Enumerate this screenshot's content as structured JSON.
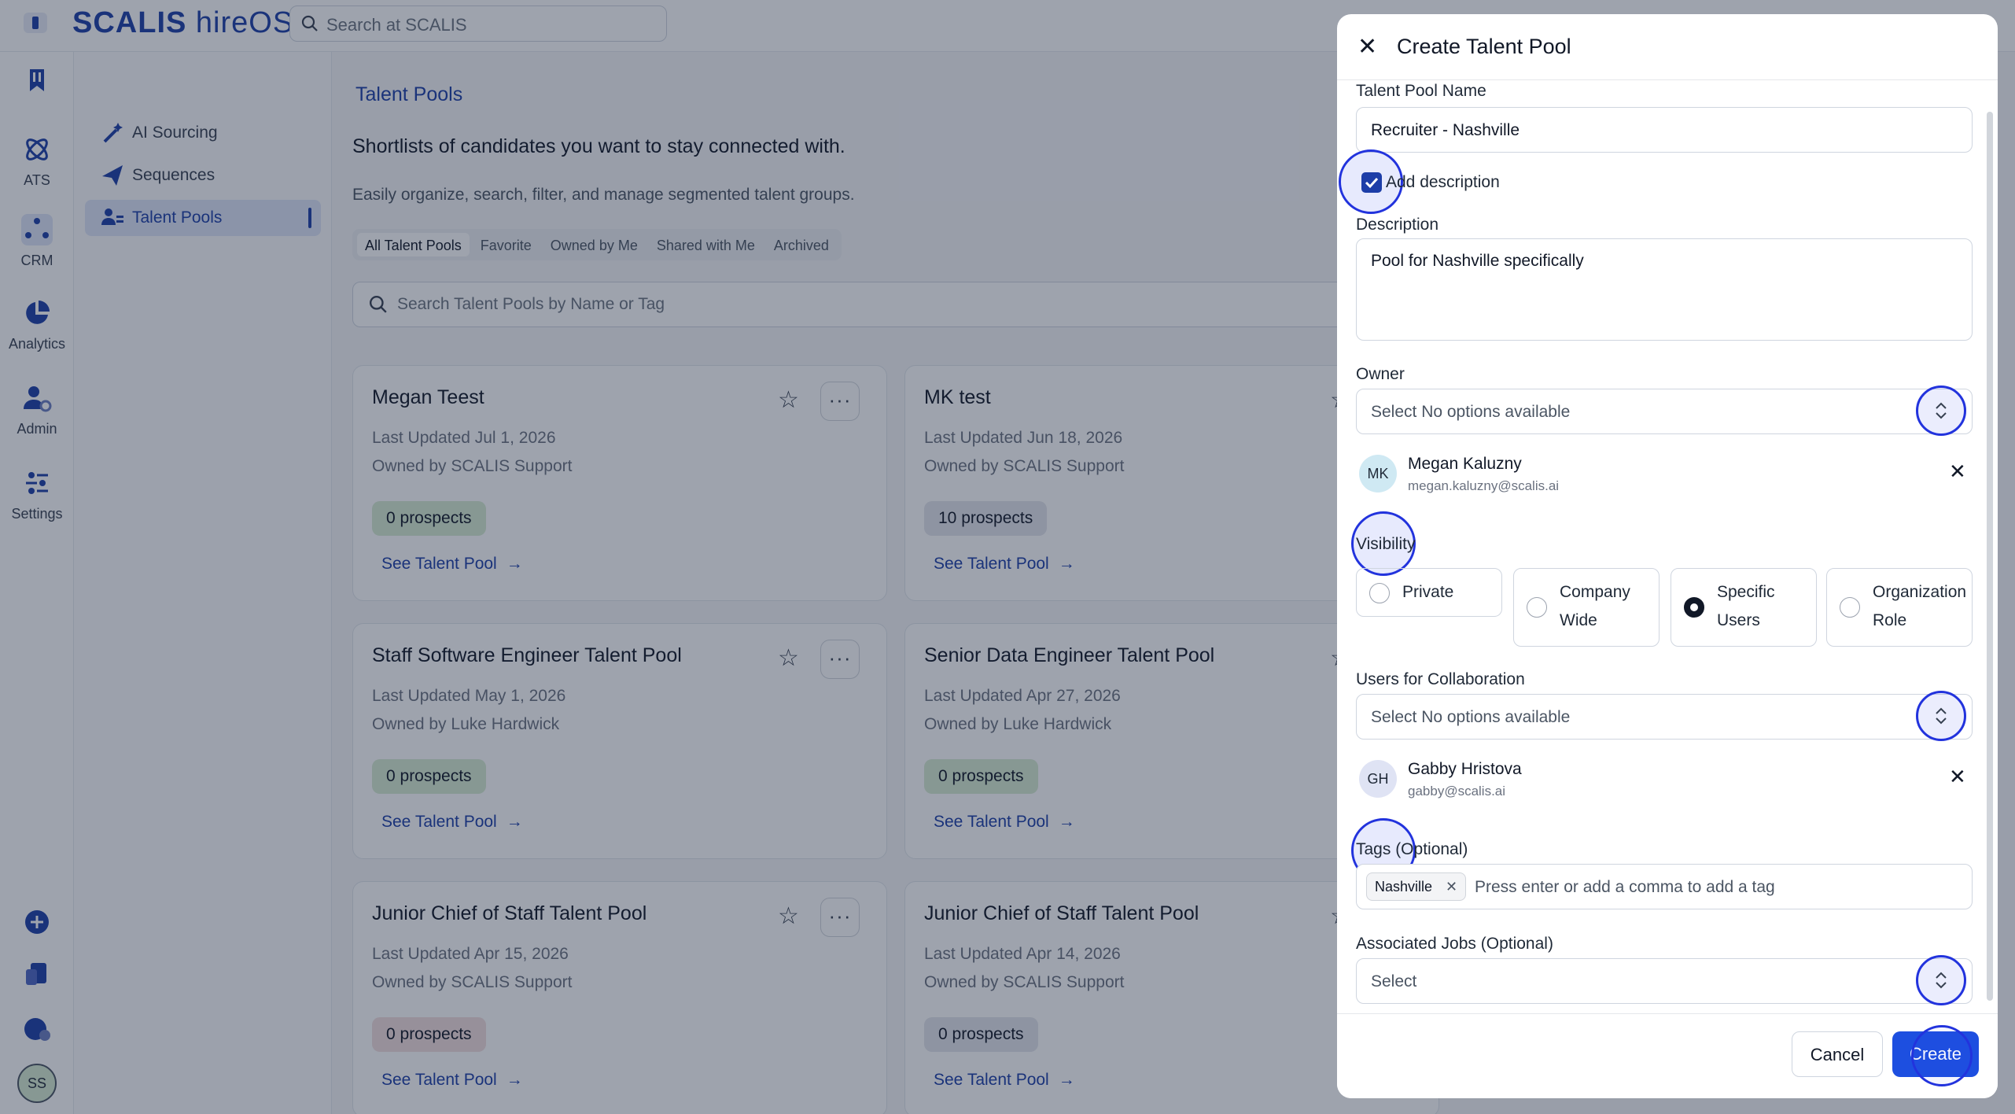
{
  "app": {
    "logo_brand": "SCALIS",
    "logo_product": "hireOS",
    "search_placeholder": "Search at SCALIS"
  },
  "rail": {
    "items": [
      {
        "label": "",
        "icon": "bookmark-icon"
      },
      {
        "label": "ATS",
        "icon": "atom-icon"
      },
      {
        "label": "CRM",
        "icon": "crm-dots-icon"
      },
      {
        "label": "Analytics",
        "icon": "pie-chart-icon"
      },
      {
        "label": "Admin",
        "icon": "user-gear-icon"
      },
      {
        "label": "Settings",
        "icon": "sliders-icon"
      }
    ],
    "user_initials": "SS"
  },
  "subnav": {
    "items": [
      {
        "label": "AI Sourcing",
        "icon": "magic-wand-icon"
      },
      {
        "label": "Sequences",
        "icon": "send-icon"
      },
      {
        "label": "Talent Pools",
        "icon": "people-icon",
        "active": true
      }
    ]
  },
  "main": {
    "breadcrumb": "Talent Pools",
    "heading": "Shortlists of candidates you want to stay connected with.",
    "subheading": "Easily organize, search, filter, and manage segmented talent groups.",
    "filters": [
      "All Talent Pools",
      "Favorite",
      "Owned by Me",
      "Shared with Me",
      "Archived"
    ],
    "search_placeholder": "Search Talent Pools by Name or Tag",
    "link_label": "See Talent Pool",
    "cards": [
      {
        "title": "Megan Teest",
        "updated": "Last Updated Jul 1, 2026",
        "owner": "Owned by SCALIS Support",
        "prospects": "0 prospects",
        "badge_color": "#d7ecd3"
      },
      {
        "title": "MK test",
        "updated": "Last Updated Jun 18, 2026",
        "owner": "Owned by SCALIS Support",
        "prospects": "10 prospects",
        "badge_color": "#e3e5ec"
      },
      {
        "title": "Staff Software Engineer Talent Pool",
        "updated": "Last Updated May 1, 2026",
        "owner": "Owned by Luke Hardwick",
        "prospects": "0 prospects",
        "badge_color": "#d7ecd3"
      },
      {
        "title": "Senior Data Engineer Talent Pool",
        "updated": "Last Updated Apr 27, 2026",
        "owner": "Owned by Luke Hardwick",
        "prospects": "0 prospects",
        "badge_color": "#d7ecd3"
      },
      {
        "title": "Junior Chief of Staff Talent Pool",
        "updated": "Last Updated Apr 15, 2026",
        "owner": "Owned by SCALIS Support",
        "prospects": "0 prospects",
        "badge_color": "#f3dede"
      },
      {
        "title": "Junior Chief of Staff Talent Pool",
        "updated": "Last Updated Apr 14, 2026",
        "owner": "Owned by SCALIS Support",
        "prospects": "0 prospects",
        "badge_color": "#e3e5ec"
      }
    ]
  },
  "modal": {
    "title": "Create Talent Pool",
    "name_label": "Talent Pool Name",
    "name_value": "Recruiter - Nashville",
    "add_description_label": "Add description",
    "add_description_checked": true,
    "description_label": "Description",
    "description_value": "Pool for Nashville specifically",
    "owner_label": "Owner",
    "owner_placeholder": "Select No options available",
    "owner": {
      "initials": "MK",
      "name": "Megan Kaluzny",
      "email": "megan.kaluzny@scalis.ai"
    },
    "visibility_label": "Visibility",
    "visibility_options": [
      {
        "line1": "Private",
        "line2": "",
        "selected": false
      },
      {
        "line1": "Company",
        "line2": "Wide",
        "selected": false
      },
      {
        "line1": "Specific",
        "line2": "Users",
        "selected": true
      },
      {
        "line1": "Organization",
        "line2": "Role",
        "selected": false
      }
    ],
    "collab_label": "Users for Collaboration",
    "collab_placeholder": "Select No options available",
    "collaborator": {
      "initials": "GH",
      "name": "Gabby Hristova",
      "email": "gabby@scalis.ai"
    },
    "tags_label": "Tags (Optional)",
    "tags": [
      "Nashville"
    ],
    "tags_placeholder": "Press enter or add a comma to add a tag",
    "jobs_label": "Associated Jobs (Optional)",
    "jobs_placeholder": "Select",
    "cancel_label": "Cancel",
    "create_label": "Create"
  }
}
